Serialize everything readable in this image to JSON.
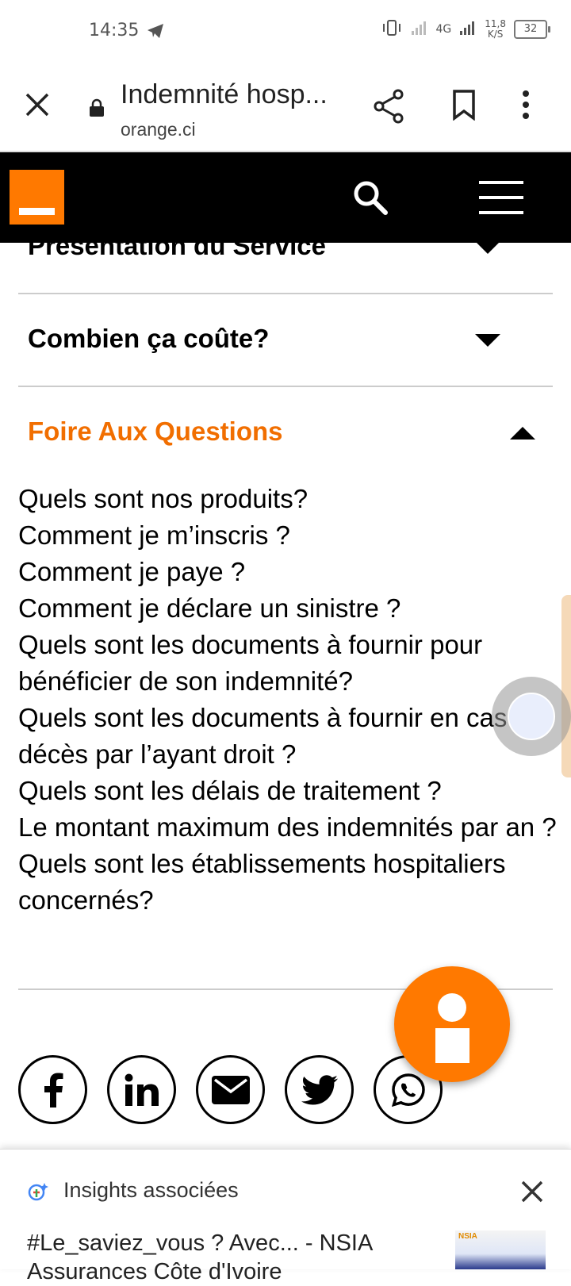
{
  "status_bar": {
    "time": "14:35",
    "network_type": "4G",
    "speed_value": "11,8",
    "speed_unit": "K/S",
    "battery": "32"
  },
  "browser": {
    "page_title": "Indemnité hosp...",
    "domain": "orange.ci"
  },
  "accordion": {
    "presentation_label": "Présentation du Service",
    "cost_label": "Combien ça coûte?",
    "faq_label": "Foire Aux Questions"
  },
  "faq_items": [
    "Quels sont nos produits?",
    "Comment je m’inscris ?",
    "Comment je paye ?",
    "Comment je déclare un sinistre ?",
    "Quels sont les documents à fournir pour bénéficier de son indemnité?",
    "Quels sont les documents à fournir en cas de décès par l’ayant droit ?",
    "Quels sont les délais de traitement ?",
    "Le montant maximum des indemnités par an ?",
    "Quels sont les établissements hospitaliers concernés?"
  ],
  "social": [
    "facebook-icon",
    "linkedin-icon",
    "email-icon",
    "twitter-icon",
    "whatsapp-icon"
  ],
  "insights": {
    "title": "Insights associées",
    "result_text": "#Le_saviez_vous ? Avec... - NSIA Assurances Côte d'Ivoire",
    "thumb_label": "NSIA"
  },
  "colors": {
    "brand_orange": "#ff7900",
    "active_text": "#f16e00"
  }
}
